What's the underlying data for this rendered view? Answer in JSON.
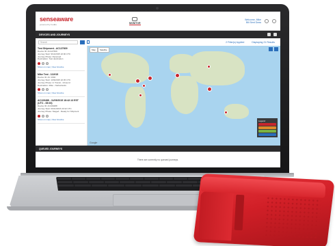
{
  "app": {
    "logo": "senseaware",
    "logo_sub": "powered by FedEx",
    "nav_label": "MONITOR",
    "user_line1": "Welcome, Mike",
    "user_line2": "Bill Sent Draw"
  },
  "devices_bar": {
    "title": "DEVICES AND JOURNEYS"
  },
  "filters": {
    "search_placeholder": "Search",
    "applied": "2 Filter(s) Applied",
    "results": "Displaying 21 Results"
  },
  "journeys": [
    {
      "title": "Test Shipment - AC127609",
      "lines": [
        "Device ID: AC127609",
        "Journey Start: 9/12/2015 22:00 UTC",
        "Journey Phase: Received",
        "Destination: Test destination"
      ],
      "links": "Show on map | View timeline"
    },
    {
      "title": "Mike Test - 111915",
      "lines": [
        "Device ID: AC 1994",
        "Journey Start: 10/9/2015 22:45 UTC",
        "Journey Phase: In Transit - Inbound",
        "Destination: Mike - Netherlands"
      ],
      "links": "Show on map | View timeline"
    },
    {
      "title": "AC109488 - 11/09/2015 18:42:13 EST (UTC - 05:00)",
      "lines": [
        "Device ID: AC109488",
        "Journey Start: 09/11/2015 23:32 UTC",
        "Journey Phase: Staged - Ready for Shipment"
      ],
      "links": "Show on map | View timeline"
    }
  ],
  "map": {
    "tab_map": "Map",
    "tab_satellite": "Satellite",
    "legend_title": "Legend",
    "legend_colors": [
      "#c8262c",
      "#e08a2a",
      "#7cb342",
      "#2a6ebb"
    ],
    "footer": "Google"
  },
  "queued": {
    "title": "QUEUED JOURNEYS",
    "message": "There are currently no queued journeys."
  },
  "colors": {
    "brand_red": "#c8262c",
    "link_blue": "#2a6ebb",
    "bar_dark": "#2b2b2d"
  }
}
